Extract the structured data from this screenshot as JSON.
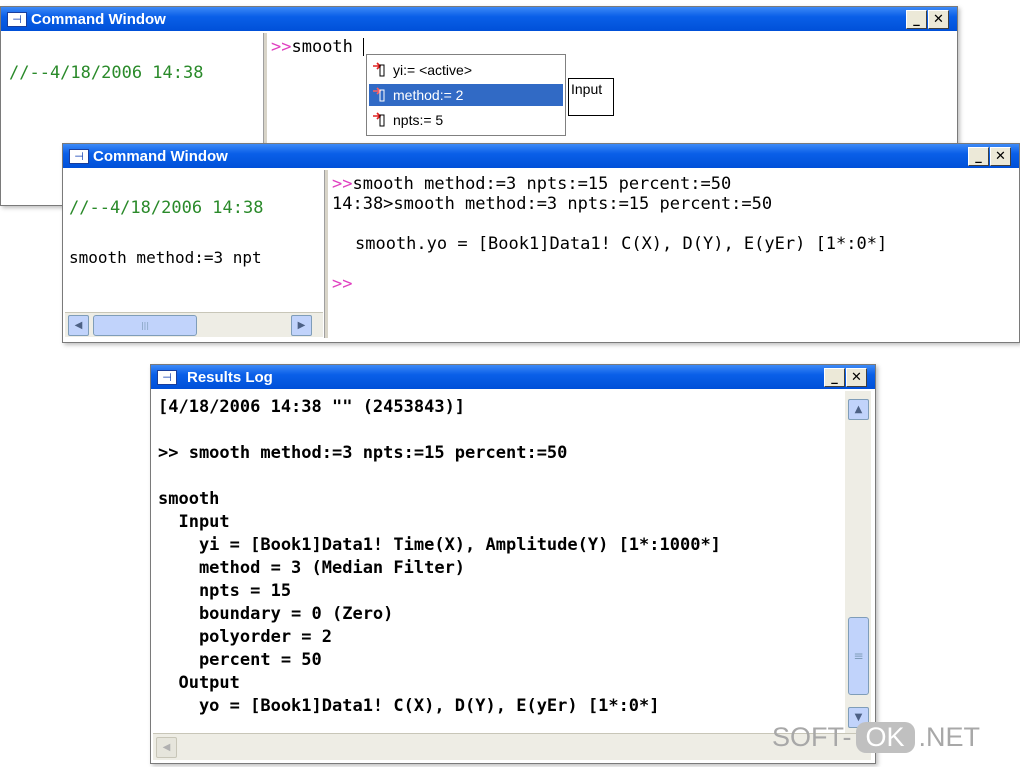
{
  "cmd_window_1": {
    "title": "Command Window",
    "history_date": "//--4/18/2006 14:38",
    "prompt": ">>",
    "input": "smooth ",
    "autocomplete": [
      {
        "label": "yi:= <active>",
        "selected": false
      },
      {
        "label": "method:= 2",
        "selected": true
      },
      {
        "label": "npts:= 5",
        "selected": false
      }
    ],
    "tooltip": "Input",
    "min_glyph": "_",
    "close_glyph": "✕"
  },
  "cmd_window_2": {
    "title": "Command Window",
    "history_date": "//--4/18/2006 14:38",
    "history_cmd": "smooth method:=3 npt",
    "prompt": ">>",
    "line1": "smooth method:=3 npts:=15 percent:=50",
    "line2": "14:38>smooth method:=3 npts:=15 percent:=50",
    "line3": "smooth.yo = [Book1]Data1! C(X), D(Y), E(yEr) [1*:0*]",
    "prompt_end": ">>",
    "min_glyph": "_",
    "close_glyph": "✕",
    "scroll_left": "◀",
    "scroll_right": "▶",
    "thumb_grip": "|||"
  },
  "results_log": {
    "title": "Results Log",
    "lines": [
      "[4/18/2006 14:38 \"\" (2453843)]",
      "",
      ">> smooth method:=3 npts:=15 percent:=50",
      "",
      "smooth",
      "  Input",
      "    yi = [Book1]Data1! Time(X), Amplitude(Y) [1*:1000*]",
      "    method = 3 (Median Filter)",
      "    npts = 15",
      "    boundary = 0 (Zero)",
      "    polyorder = 2",
      "    percent = 50",
      "  Output",
      "    yo = [Book1]Data1! C(X), D(Y), E(yEr) [1*:0*]"
    ],
    "min_glyph": "_",
    "close_glyph": "✕",
    "scroll_up": "▲",
    "scroll_down": "▼",
    "scroll_left": "◀",
    "thumb_grip": "≡"
  },
  "watermark": {
    "pre": "SOFT-",
    "ok": "OK",
    "post": ".NET"
  }
}
